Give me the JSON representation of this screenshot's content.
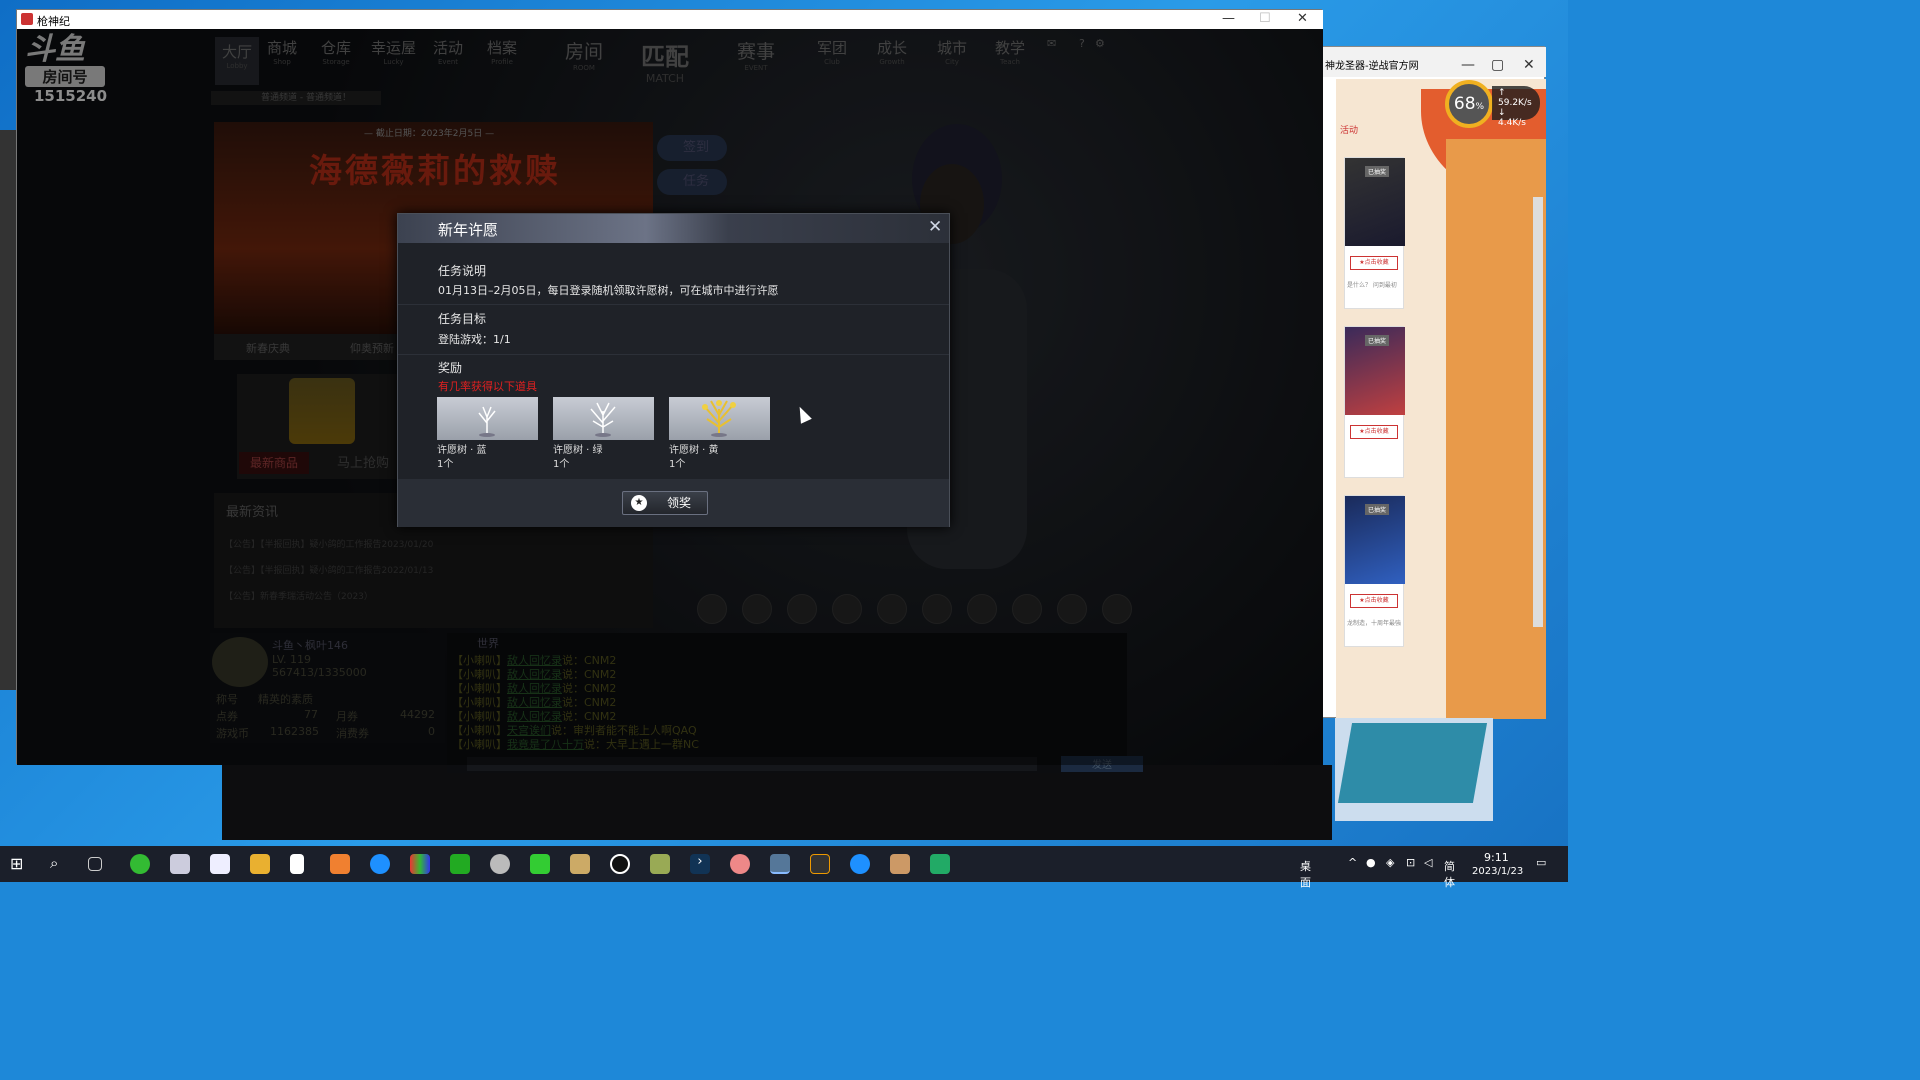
{
  "desktop": {
    "browser": {
      "title": "神龙圣器-逆战官方网",
      "tab_label": "活动",
      "cards": [
        {
          "badge": "已抽奖",
          "button": "★点击收藏",
          "caption": "是什么？ 问到最初"
        },
        {
          "badge": "已抽奖",
          "button": "★点击收藏",
          "caption": ""
        },
        {
          "badge": "已抽奖",
          "button": "★点击收藏",
          "caption": "龙制造，十周年最強"
        }
      ]
    },
    "net_speed": {
      "percent": "68",
      "percent_unit": "%",
      "up": "59.2",
      "up_unit": "K/s",
      "down": "4.4",
      "down_unit": "K/s"
    }
  },
  "game": {
    "window_title": "枪神纪",
    "window_buttons": {
      "minimize": "—",
      "maximize": "☐",
      "close": "✕"
    },
    "logo": {
      "brand": "斗鱼",
      "label": "房间号",
      "room_number": "1515240"
    },
    "nav": [
      {
        "label": "大厅",
        "sub": "Lobby"
      },
      {
        "label": "商城",
        "sub": "Shop"
      },
      {
        "label": "仓库",
        "sub": "Storage"
      },
      {
        "label": "幸运屋",
        "sub": "Lucky"
      },
      {
        "label": "活动",
        "sub": "Event"
      },
      {
        "label": "档案",
        "sub": "Profile"
      },
      {
        "label": "房间",
        "sub": "ROOM"
      },
      {
        "label": "匹配",
        "sub": "MATCH"
      },
      {
        "label": "赛事",
        "sub": "EVENT"
      },
      {
        "label": "军团",
        "sub": "Club"
      },
      {
        "label": "成长",
        "sub": "Growth"
      },
      {
        "label": "城市",
        "sub": "City"
      },
      {
        "label": "教学",
        "sub": "Teach"
      }
    ],
    "marquee": "普通频道 - 普通频道！",
    "banner": {
      "date": "— 截止日期：2023年2月5日 —",
      "title": "海德薇莉的救赎"
    },
    "banner_tabs": [
      "新春庆典",
      "仰奥预新"
    ],
    "side_buttons": [
      "签到",
      "任务"
    ],
    "shop": {
      "tag": "最新商品",
      "link": "马上抢购"
    },
    "news": {
      "header": "最新资讯",
      "items": [
        "【公告】【半报回执】疑小鸽的工作报告2023/01/20",
        "【公告】【半报回执】疑小鸽的工作报告2022/01/13",
        "【公告】新春季瑞活动公告（2023）"
      ]
    },
    "profile": {
      "name": "斗鱼丶枫叶146",
      "level": "LV. 119",
      "exp": "567413/1335000",
      "title_label": "称号",
      "title_value": "精英的素质",
      "points_label": "点券",
      "points": "77",
      "monthly_label": "月券",
      "monthly": "44292",
      "coins_label": "游戏币",
      "coins": "1162385",
      "consume_label": "消费券",
      "consume": "0"
    },
    "chat": {
      "tab": "世界",
      "lines": [
        {
          "tag": "【小喇叭】",
          "user": "敌人回忆录",
          "text": "说：CNM2"
        },
        {
          "tag": "【小喇叭】",
          "user": "敌人回忆录",
          "text": "说：CNM2"
        },
        {
          "tag": "【小喇叭】",
          "user": "敌人回忆录",
          "text": "说：CNM2"
        },
        {
          "tag": "【小喇叭】",
          "user": "敌人回忆录",
          "text": "说：CNM2"
        },
        {
          "tag": "【小喇叭】",
          "user": "敌人回忆录",
          "text": "说：CNM2"
        },
        {
          "tag": "【小喇叭】",
          "user": "天宫诶们",
          "text": "说：审判者能不能上人啊QAQ"
        },
        {
          "tag": "【小喇叭】",
          "user": "我竟是了八十万",
          "text": "说：大早上遇上一群NC"
        }
      ],
      "send": "发送"
    }
  },
  "dialog": {
    "title": "新年许愿",
    "close": "✕",
    "desc_heading": "任务说明",
    "desc_text": "01月13日–2月05日，每日登录随机领取许愿树，可在城市中进行许愿",
    "goal_heading": "任务目标",
    "goal_text": "登陆游戏：1/1",
    "reward_heading": "奖励",
    "reward_note": "有几率获得以下道具",
    "items": [
      {
        "name": "许愿树 · 蓝",
        "count": "1个"
      },
      {
        "name": "许愿树 · 绿",
        "count": "1个"
      },
      {
        "name": "许愿树 · 黄",
        "count": "1个"
      }
    ],
    "claim_button": "领奖"
  },
  "taskbar": {
    "desktop_label": "桌面",
    "ime": "简体",
    "time": "9:11",
    "date": "2023/1/23"
  },
  "colors": {
    "dialog_bg": "#1f2228",
    "reward_note": "#e02020",
    "taskbar": "#1b1f2a"
  }
}
